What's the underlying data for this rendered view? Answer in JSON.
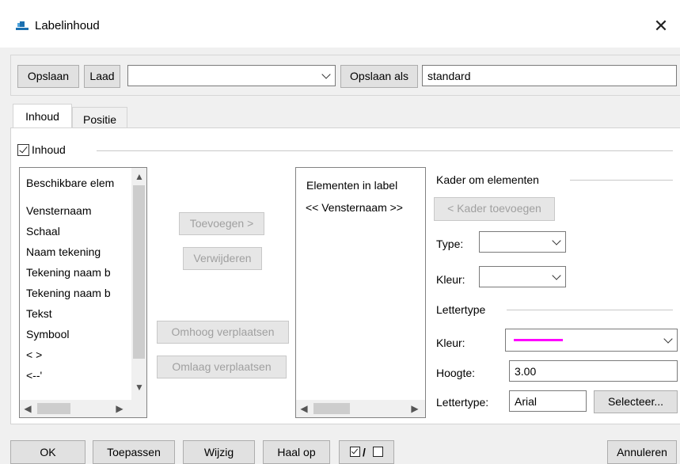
{
  "window": {
    "title": "Labelinhoud"
  },
  "toolbar": {
    "save_label": "Opslaan",
    "load_label": "Laad",
    "preset_value": "",
    "save_as_label": "Opslaan als",
    "name_value": "standard"
  },
  "tabs": [
    {
      "label": "Inhoud",
      "active": true
    },
    {
      "label": "Positie",
      "active": false
    }
  ],
  "content": {
    "group_label": "Inhoud",
    "available": {
      "header": "Beschikbare elem",
      "items": [
        "Vensternaam",
        "Schaal",
        "Naam tekening",
        "Tekening naam b",
        "Tekening naam b",
        "Tekst",
        "Symbool",
        "< >",
        "<--'"
      ]
    },
    "buttons": {
      "add": "Toevoegen >",
      "remove": "Verwijderen",
      "move_up": "Omhoog verplaatsen",
      "move_down": "Omlaag verplaatsen"
    },
    "in_label": {
      "header": "Elementen in label",
      "items": [
        "<< Vensternaam >>"
      ]
    }
  },
  "frame": {
    "title": "Kader om elementen",
    "add_button": "< Kader toevoegen",
    "type_label": "Type:",
    "type_value": "",
    "color_label": "Kleur:",
    "color_value": ""
  },
  "font": {
    "title": "Lettertype",
    "color_label": "Kleur:",
    "color_hex": "#ff00ff",
    "height_label": "Hoogte:",
    "height_value": "3.00",
    "font_label": "Lettertype:",
    "font_value": "Arial",
    "select_button": "Selecteer..."
  },
  "footer": {
    "ok": "OK",
    "apply": "Toepassen",
    "modify": "Wijzig",
    "fetch": "Haal op",
    "toggle": "/",
    "cancel": "Annuleren"
  }
}
